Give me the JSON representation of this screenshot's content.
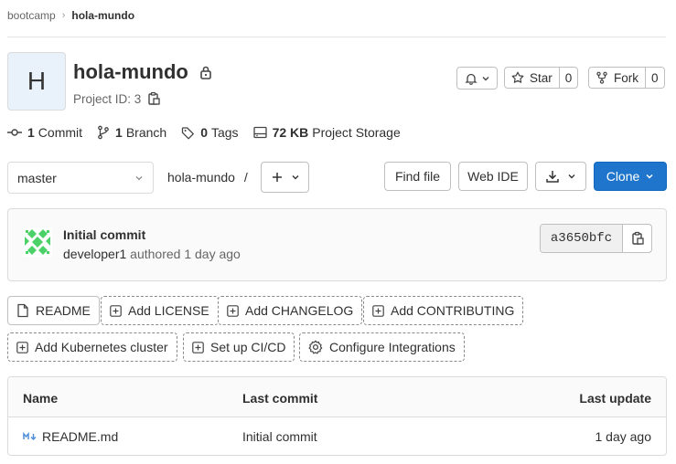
{
  "breadcrumb": {
    "parent": "bootcamp",
    "current": "hola-mundo"
  },
  "project": {
    "avatar_letter": "H",
    "name": "hola-mundo",
    "id_text": "Project ID: 3"
  },
  "actions": {
    "star_label": "Star",
    "star_count": "0",
    "fork_label": "Fork",
    "fork_count": "0"
  },
  "stats": {
    "commits": {
      "count": "1",
      "label": "Commit"
    },
    "branches": {
      "count": "1",
      "label": "Branch"
    },
    "tags": {
      "count": "0",
      "label": "Tags"
    },
    "storage": {
      "count": "72 KB",
      "label": "Project Storage"
    }
  },
  "repo_nav": {
    "branch": "master",
    "path": "hola-mundo",
    "path_sep": "/",
    "find_file": "Find file",
    "web_ide": "Web IDE",
    "clone": "Clone"
  },
  "commit": {
    "title": "Initial commit",
    "author": "developer1",
    "authored_text": "authored 1 day ago",
    "sha": "a3650bfc"
  },
  "quick_actions": {
    "readme": "README",
    "add_license": "Add LICENSE",
    "add_changelog": "Add CHANGELOG",
    "add_contributing": "Add CONTRIBUTING",
    "add_kubernetes": "Add Kubernetes cluster",
    "setup_cicd": "Set up CI/CD",
    "configure_integrations": "Configure Integrations"
  },
  "files": {
    "headers": {
      "name": "Name",
      "last_commit": "Last commit",
      "last_update": "Last update"
    },
    "rows": [
      {
        "name": "README.md",
        "last_commit": "Initial commit",
        "last_update": "1 day ago"
      }
    ]
  },
  "colors": {
    "primary": "#1f75cb",
    "avatar_bg": "#e9f1fb",
    "identicon": "#4bd168"
  }
}
